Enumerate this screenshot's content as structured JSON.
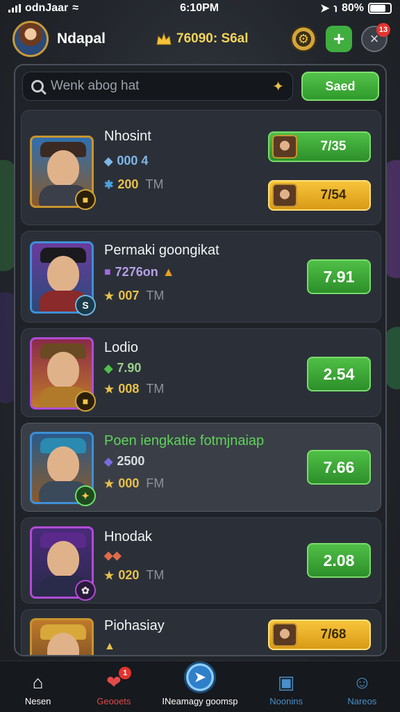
{
  "status_bar": {
    "carrier": "odnJaar",
    "time": "6:10PM",
    "battery": "80%"
  },
  "header": {
    "username": "Ndapal",
    "currency": "76090: S6al",
    "notification_count": "13"
  },
  "search": {
    "placeholder": "Wenk abog hat",
    "button_label": "Saed"
  },
  "heroes": [
    {
      "name": "Nhosint",
      "gems": "000 4",
      "stars": "200",
      "stars_unit": "TM",
      "offers": [
        "7/35",
        "7/54"
      ]
    },
    {
      "name": "Permaki goongikat",
      "gems": "7276on",
      "stars": "007",
      "stars_unit": "TM",
      "value": "7.91",
      "badge": "S"
    },
    {
      "name": "Lodio",
      "gems": "7.90",
      "stars": "008",
      "stars_unit": "TM",
      "value": "2.54"
    },
    {
      "name": "Poen iengkatie fotmjnaiap",
      "gems": "2500",
      "stars": "000",
      "stars_unit": "FM",
      "value": "7.66"
    },
    {
      "name": "Hnodak",
      "stars": "020",
      "stars_unit": "TM",
      "value": "2.08"
    },
    {
      "name": "Piohasiay",
      "offer": "7/68"
    }
  ],
  "bottom_nav": {
    "items": [
      {
        "label": "Nesen"
      },
      {
        "label": "Geooets",
        "badge": "1"
      },
      {
        "label": "INeamagy goomsp"
      },
      {
        "label": "Noonins"
      },
      {
        "label": "Nareos"
      }
    ]
  },
  "colors": {
    "accent_green": "#3fae3f",
    "accent_gold": "#f7c43a",
    "panel_bg": "#1f2329"
  }
}
